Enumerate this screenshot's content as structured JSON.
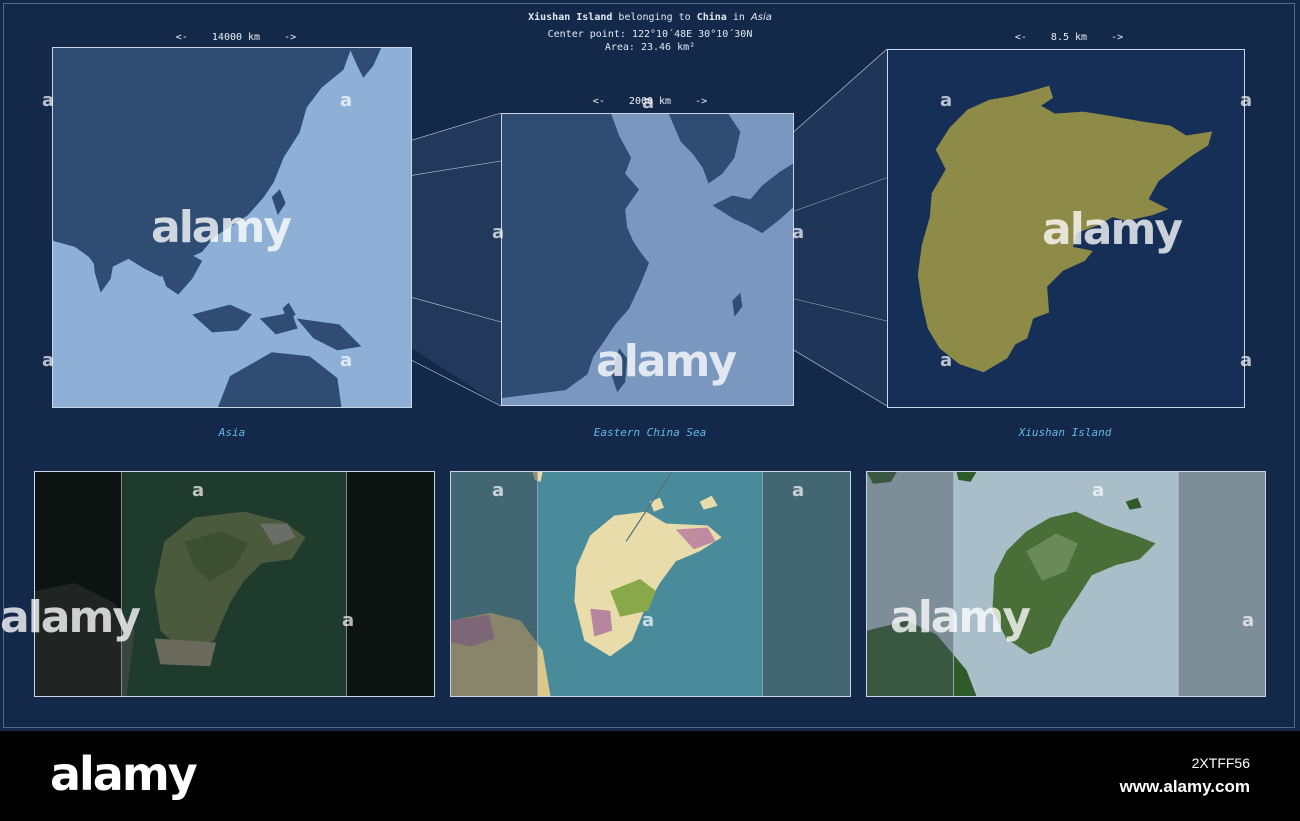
{
  "header": {
    "place": "Xiushan Island",
    "belonging_to": "belonging to",
    "country": "China",
    "in_word": "in",
    "continent": "Asia",
    "center_label": "Center point:",
    "center_value": "122°10´48E  30°10´30N",
    "area_label": "Area:",
    "area_value": "23.46 km²"
  },
  "scales": {
    "asia": "<-    14000 km    ->",
    "sea": "<-    2000 km    ->",
    "island": "<-    8.5 km    ->"
  },
  "captions": {
    "asia": "Asia",
    "sea": "Eastern China Sea",
    "island": "Xiushan Island"
  },
  "colors": {
    "background": "#14294a",
    "land_dark": "#2f4c73",
    "land_light": "#6f8fb6",
    "highlight": "#8e8a48",
    "caption": "#5fb8e8"
  },
  "watermark": {
    "text": "alamy",
    "letter": "a"
  },
  "footer": {
    "logo": "alamy",
    "image_code": "2XTFF56",
    "site": "www.alamy.com"
  }
}
